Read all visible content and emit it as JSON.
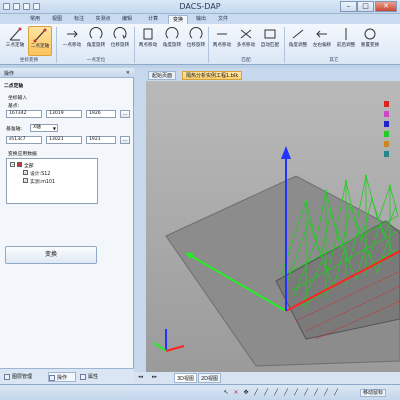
{
  "app": {
    "title": "DACS-DAP"
  },
  "tabs": [
    "常用",
    "视图",
    "标注",
    "实测点",
    "编辑",
    "计算",
    "变换",
    "输出",
    "文件"
  ],
  "active_tab": "变换",
  "ribbon": {
    "buttons": [
      "三点定轴",
      "二点定轴",
      "一点移动",
      "角度旋转",
      "位移旋转",
      "两点移动",
      "角度旋转",
      "位移旋转",
      "两点移动",
      "多点移动",
      "自动匹配",
      "角度调整",
      "左右偏移",
      "前后调整",
      "重置变换"
    ],
    "selected": "二点定轴",
    "groups": [
      "坐标变换",
      "一点定位",
      "匹配",
      "其它"
    ]
  },
  "left_panel": {
    "title": "操作",
    "section_title": "二点定轴",
    "subsection_title": "坐标输入",
    "origin_label": "基点:",
    "origin_values": [
      "167342",
      "13019",
      "1926"
    ],
    "base_axis_label": "基准轴:",
    "base_axis_value": "X轴",
    "axis_values": [
      "sh13c7",
      "13021",
      "1921"
    ],
    "tree_title": "变换应用数据",
    "tree_items": [
      "全部",
      "设计:S12",
      "实测:m101"
    ],
    "transform_button": "变换",
    "bottom_tabs": [
      "图层管理",
      "操作",
      "属性"
    ]
  },
  "doc": {
    "tabs": [
      "起始页面",
      "隔热分析实例工程1.blk"
    ],
    "active_tab": "隔热分析实例工程1.blk"
  },
  "view_tabs": [
    "3D视图",
    "2D视图"
  ],
  "active_view_tab": "3D视图",
  "colors": {
    "ground": "#8a8a8a",
    "mesh": "#22cc22",
    "x_axis": "#ff2222",
    "y_axis": "#22ee22",
    "z_axis": "#2233ff",
    "ribbon_selected": "#fbc25c"
  },
  "status": {
    "mode": "移动鼠标"
  }
}
